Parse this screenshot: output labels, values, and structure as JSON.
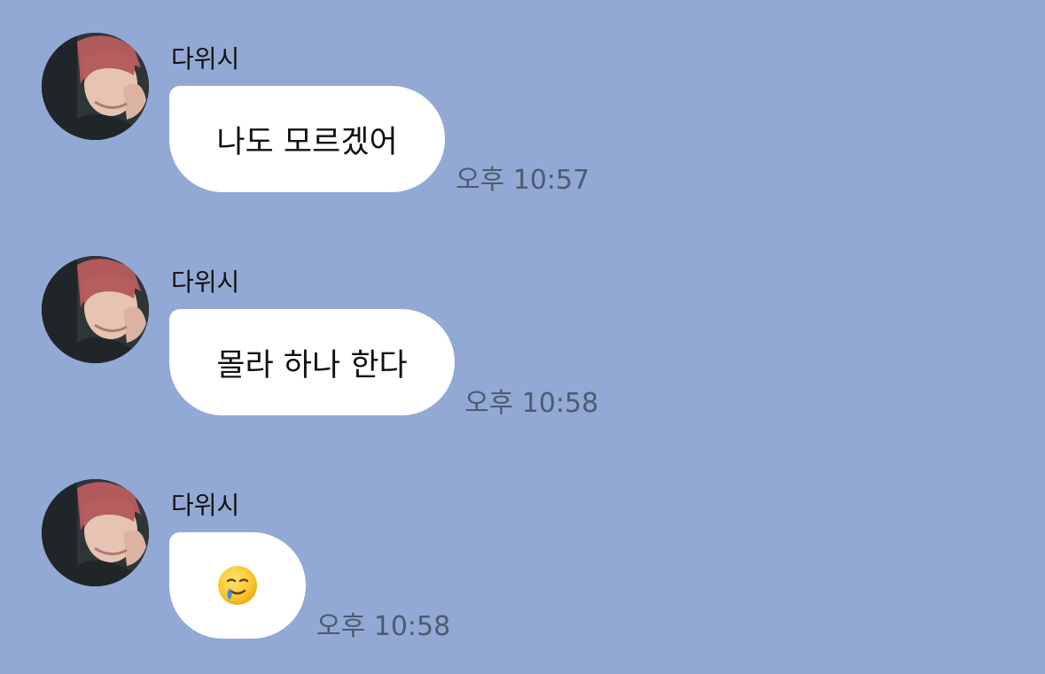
{
  "chat": {
    "messages": [
      {
        "sender": "다위시",
        "text": "나도 모르겠어",
        "time": "오후 10:57"
      },
      {
        "sender": "다위시",
        "text": "몰라 하나 한다",
        "time": "오후 10:58"
      },
      {
        "sender": "다위시",
        "emoji": "smiling-face-with-tear",
        "time": "오후 10:58"
      }
    ]
  },
  "colors": {
    "background": "#92a9d5",
    "bubble": "#ffffff",
    "timestamp": "#4e5b6e"
  }
}
